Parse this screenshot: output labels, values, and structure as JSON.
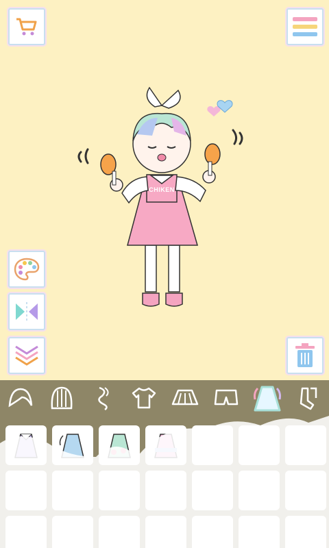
{
  "app": {
    "shirt_text": "CHIKEN"
  },
  "buttons": {
    "shop": "shopping-cart-icon",
    "menu": "menu-icon",
    "palette": "palette-icon",
    "flip": "flip-icon",
    "layer": "layer-down-icon",
    "trash": "trash-icon"
  },
  "categories": [
    {
      "name": "hair-front-icon",
      "selected": false
    },
    {
      "name": "hair-back-icon",
      "selected": false
    },
    {
      "name": "hair-accessory-icon",
      "selected": false
    },
    {
      "name": "top-icon",
      "selected": false
    },
    {
      "name": "skirt-icon",
      "selected": false
    },
    {
      "name": "shorts-icon",
      "selected": false
    },
    {
      "name": "dress-icon",
      "selected": true
    },
    {
      "name": "socks-icon",
      "selected": false
    }
  ],
  "colors": {
    "background": "#fdf1c2",
    "panel": "#8e8667",
    "accent_pink": "#f4a4c0",
    "accent_blue": "#9fd0f0"
  }
}
